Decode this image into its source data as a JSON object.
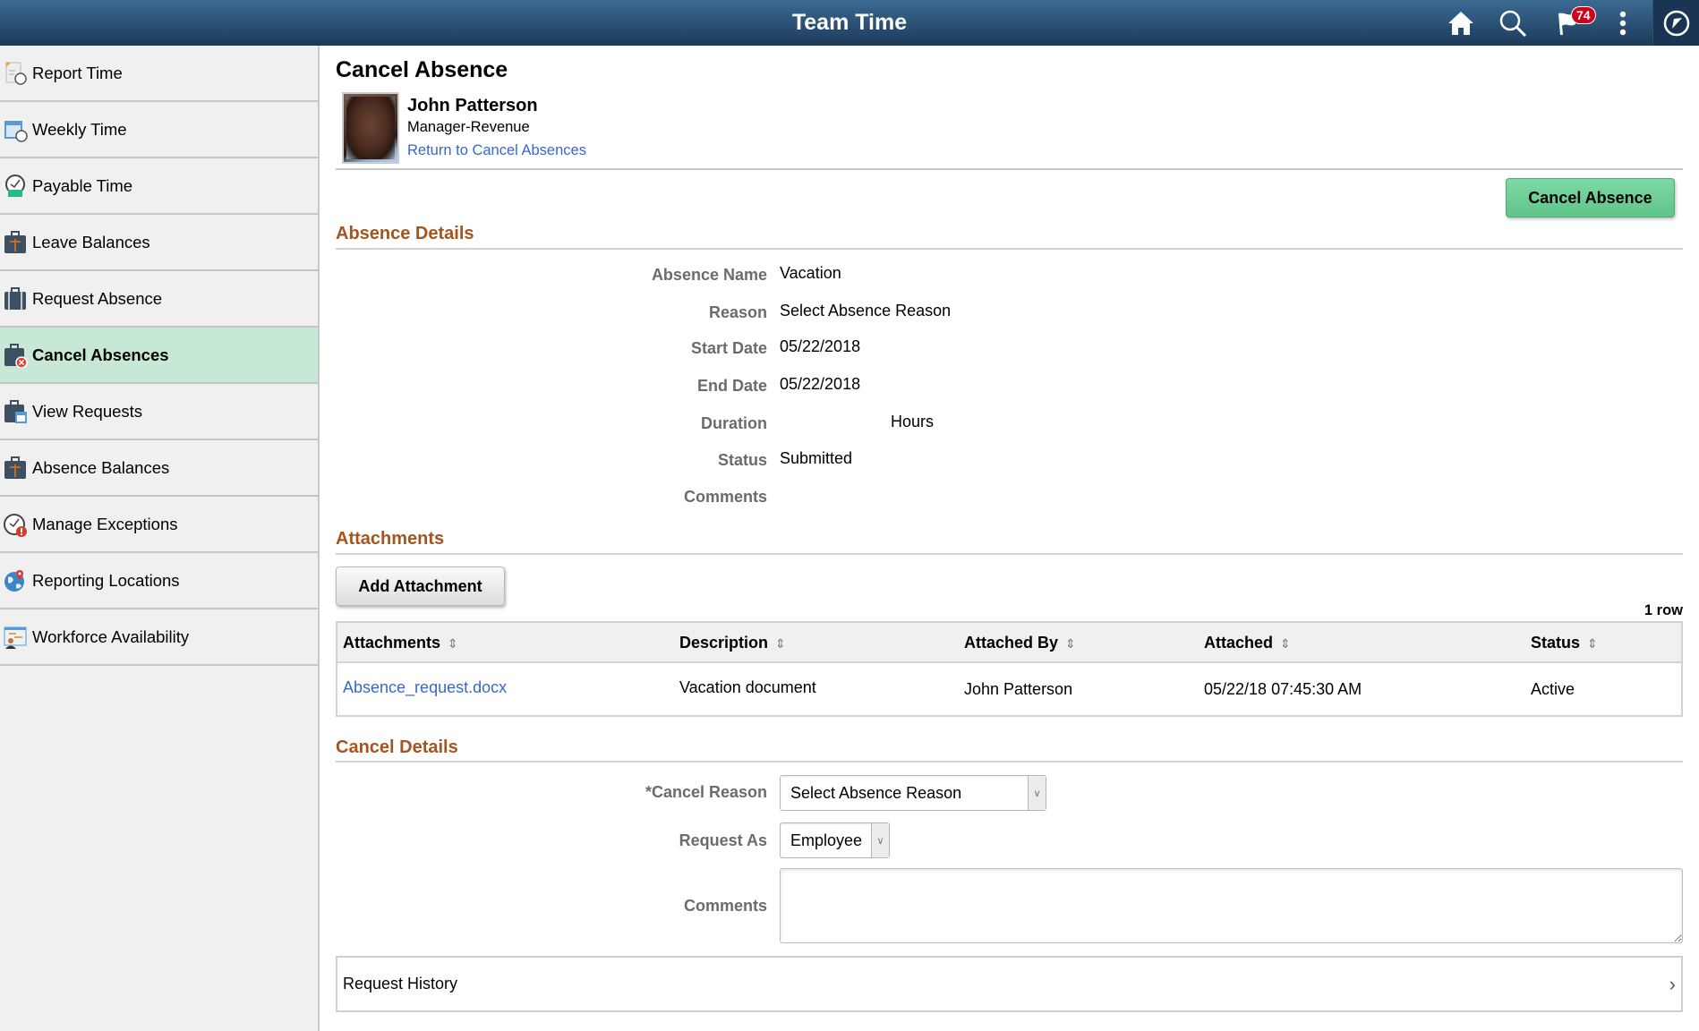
{
  "header": {
    "title": "Team Time",
    "icons": [
      "home-icon",
      "search-icon",
      "notifications-flag-icon",
      "actions-menu-icon",
      "navbar-compass-icon"
    ],
    "notification_count": "74"
  },
  "sidebar": {
    "items": [
      {
        "label": "Report Time",
        "icon": "report-time-icon",
        "active": false
      },
      {
        "label": "Weekly Time",
        "icon": "weekly-time-icon",
        "active": false
      },
      {
        "label": "Payable Time",
        "icon": "payable-time-icon",
        "active": false
      },
      {
        "label": "Leave Balances",
        "icon": "leave-balances-icon",
        "active": false
      },
      {
        "label": "Request Absence",
        "icon": "request-absence-icon",
        "active": false
      },
      {
        "label": "Cancel Absences",
        "icon": "cancel-absences-icon",
        "active": true
      },
      {
        "label": "View Requests",
        "icon": "view-requests-icon",
        "active": false
      },
      {
        "label": "Absence Balances",
        "icon": "absence-balances-icon",
        "active": false
      },
      {
        "label": "Manage Exceptions",
        "icon": "manage-exceptions-icon",
        "active": false
      },
      {
        "label": "Reporting Locations",
        "icon": "reporting-locations-icon",
        "active": false
      },
      {
        "label": "Workforce Availability",
        "icon": "workforce-availability-icon",
        "active": false
      }
    ]
  },
  "page": {
    "title": "Cancel Absence",
    "employee": {
      "name": "John Patterson",
      "job_title": "Manager-Revenue",
      "return_link": "Return to Cancel Absences"
    },
    "primary_button": "Cancel Absence"
  },
  "absence_details": {
    "heading": "Absence Details",
    "fields": [
      {
        "label": "Absence Name",
        "value": "Vacation"
      },
      {
        "label": "Reason",
        "value": "Select Absence Reason"
      },
      {
        "label": "Start Date",
        "value": "05/22/2018"
      },
      {
        "label": "End Date",
        "value": "05/22/2018"
      },
      {
        "label": "Duration",
        "value": "Hours"
      },
      {
        "label": "Status",
        "value": "Submitted"
      },
      {
        "label": "Comments",
        "value": ""
      }
    ]
  },
  "attachments": {
    "heading": "Attachments",
    "add_button": "Add Attachment",
    "row_count": "1 row",
    "columns": [
      "Attachments",
      "Description",
      "Attached By",
      "Attached",
      "Status"
    ],
    "rows": [
      [
        "Absence_request.docx",
        "Vacation document",
        "John Patterson",
        "05/22/18 07:45:30 AM",
        "Active"
      ]
    ]
  },
  "cancel_details": {
    "heading": "Cancel Details",
    "cancel_reason_label": "*Cancel Reason",
    "cancel_reason_value": "Select Absence Reason",
    "request_as_label": "Request As",
    "request_as_value": "Employee",
    "comments_label": "Comments",
    "comments_value": ""
  },
  "request_history": {
    "label": "Request History"
  },
  "colors": {
    "banner": "#2b4f74",
    "section_heading": "#a5541e",
    "link": "#3868c8",
    "active_nav": "#c8e8d6",
    "primary_button": "#6ccf95",
    "badge": "#d0021b"
  }
}
